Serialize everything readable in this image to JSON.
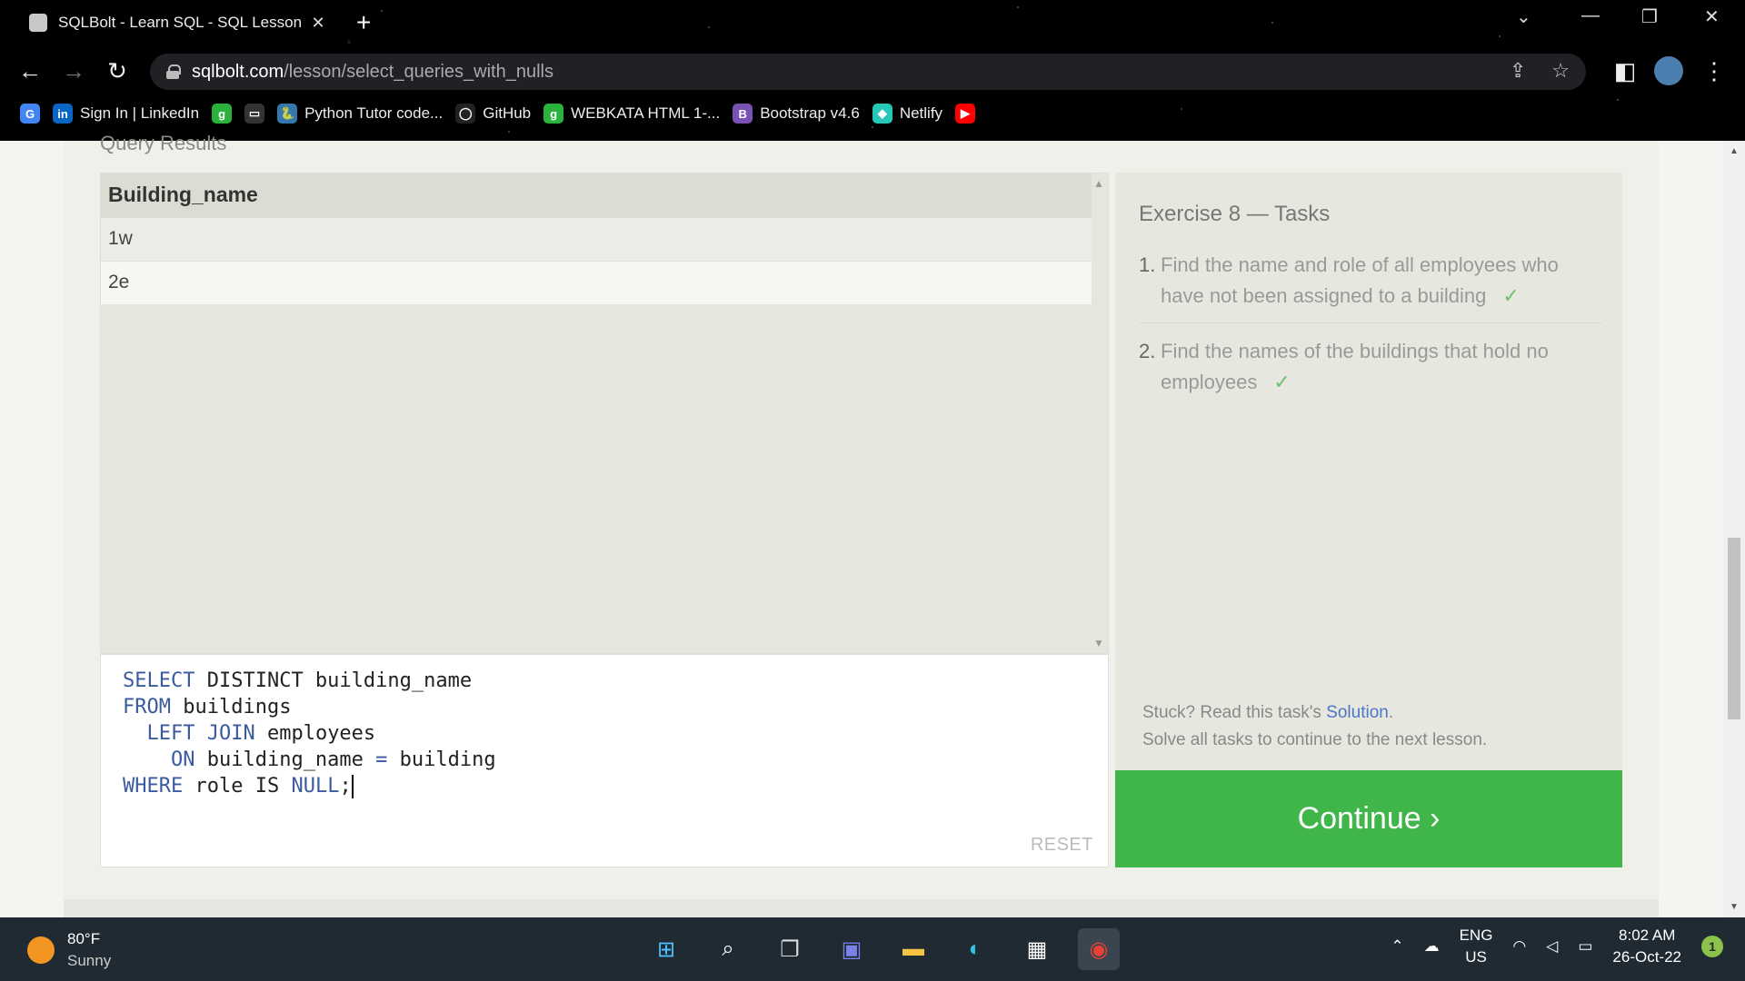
{
  "browser": {
    "tab_title": "SQLBolt - Learn SQL - SQL Lesson",
    "new_tab": "+",
    "url_host": "sqlbolt.com",
    "url_path": "/lesson/select_queries_with_nulls",
    "bookmarks": [
      {
        "label": "",
        "icon": "google-icon",
        "color": "#4285f4"
      },
      {
        "label": "Sign In | LinkedIn",
        "icon": "linkedin-icon",
        "color": "#0a66c2"
      },
      {
        "label": "",
        "icon": "guvi-icon",
        "color": "#2ab23c"
      },
      {
        "label": "",
        "icon": "page-icon",
        "color": "#333333"
      },
      {
        "label": "Python Tutor code...",
        "icon": "python-icon",
        "color": "#3776ab"
      },
      {
        "label": "GitHub",
        "icon": "github-icon",
        "color": "#222222"
      },
      {
        "label": "WEBKATA HTML 1-...",
        "icon": "guvi-icon",
        "color": "#2ab23c"
      },
      {
        "label": "Bootstrap v4.6",
        "icon": "bootstrap-icon",
        "color": "#7952b3"
      },
      {
        "label": "Netlify",
        "icon": "netlify-icon",
        "color": "#25c7b7"
      },
      {
        "label": "",
        "icon": "youtube-icon",
        "color": "#ff0000"
      }
    ]
  },
  "page": {
    "results_title": "Query Results",
    "results": {
      "columns": [
        "Building_name"
      ],
      "rows": [
        [
          "1w"
        ],
        [
          "2e"
        ]
      ]
    },
    "editor": {
      "reset_label": "RESET"
    },
    "tasks": {
      "title": "Exercise 8 — Tasks",
      "items": [
        {
          "number": "1.",
          "text": "Find the name and role of all employees who have not been assigned to a building",
          "check": "✓"
        },
        {
          "number": "2.",
          "text": "Find the names of the buildings that hold no employees",
          "check": "✓"
        }
      ],
      "stuck_prefix": "Stuck? Read this task's ",
      "solution_link": "Solution",
      "stuck_suffix": ".",
      "solve_all": "Solve all tasks to continue to the next lesson."
    },
    "continue_label": "Continue ›"
  },
  "taskbar": {
    "temperature": "80°F",
    "condition": "Sunny",
    "language": "ENG",
    "region": "US",
    "time": "8:02 AM",
    "date": "26-Oct-22",
    "notifications": "1"
  }
}
